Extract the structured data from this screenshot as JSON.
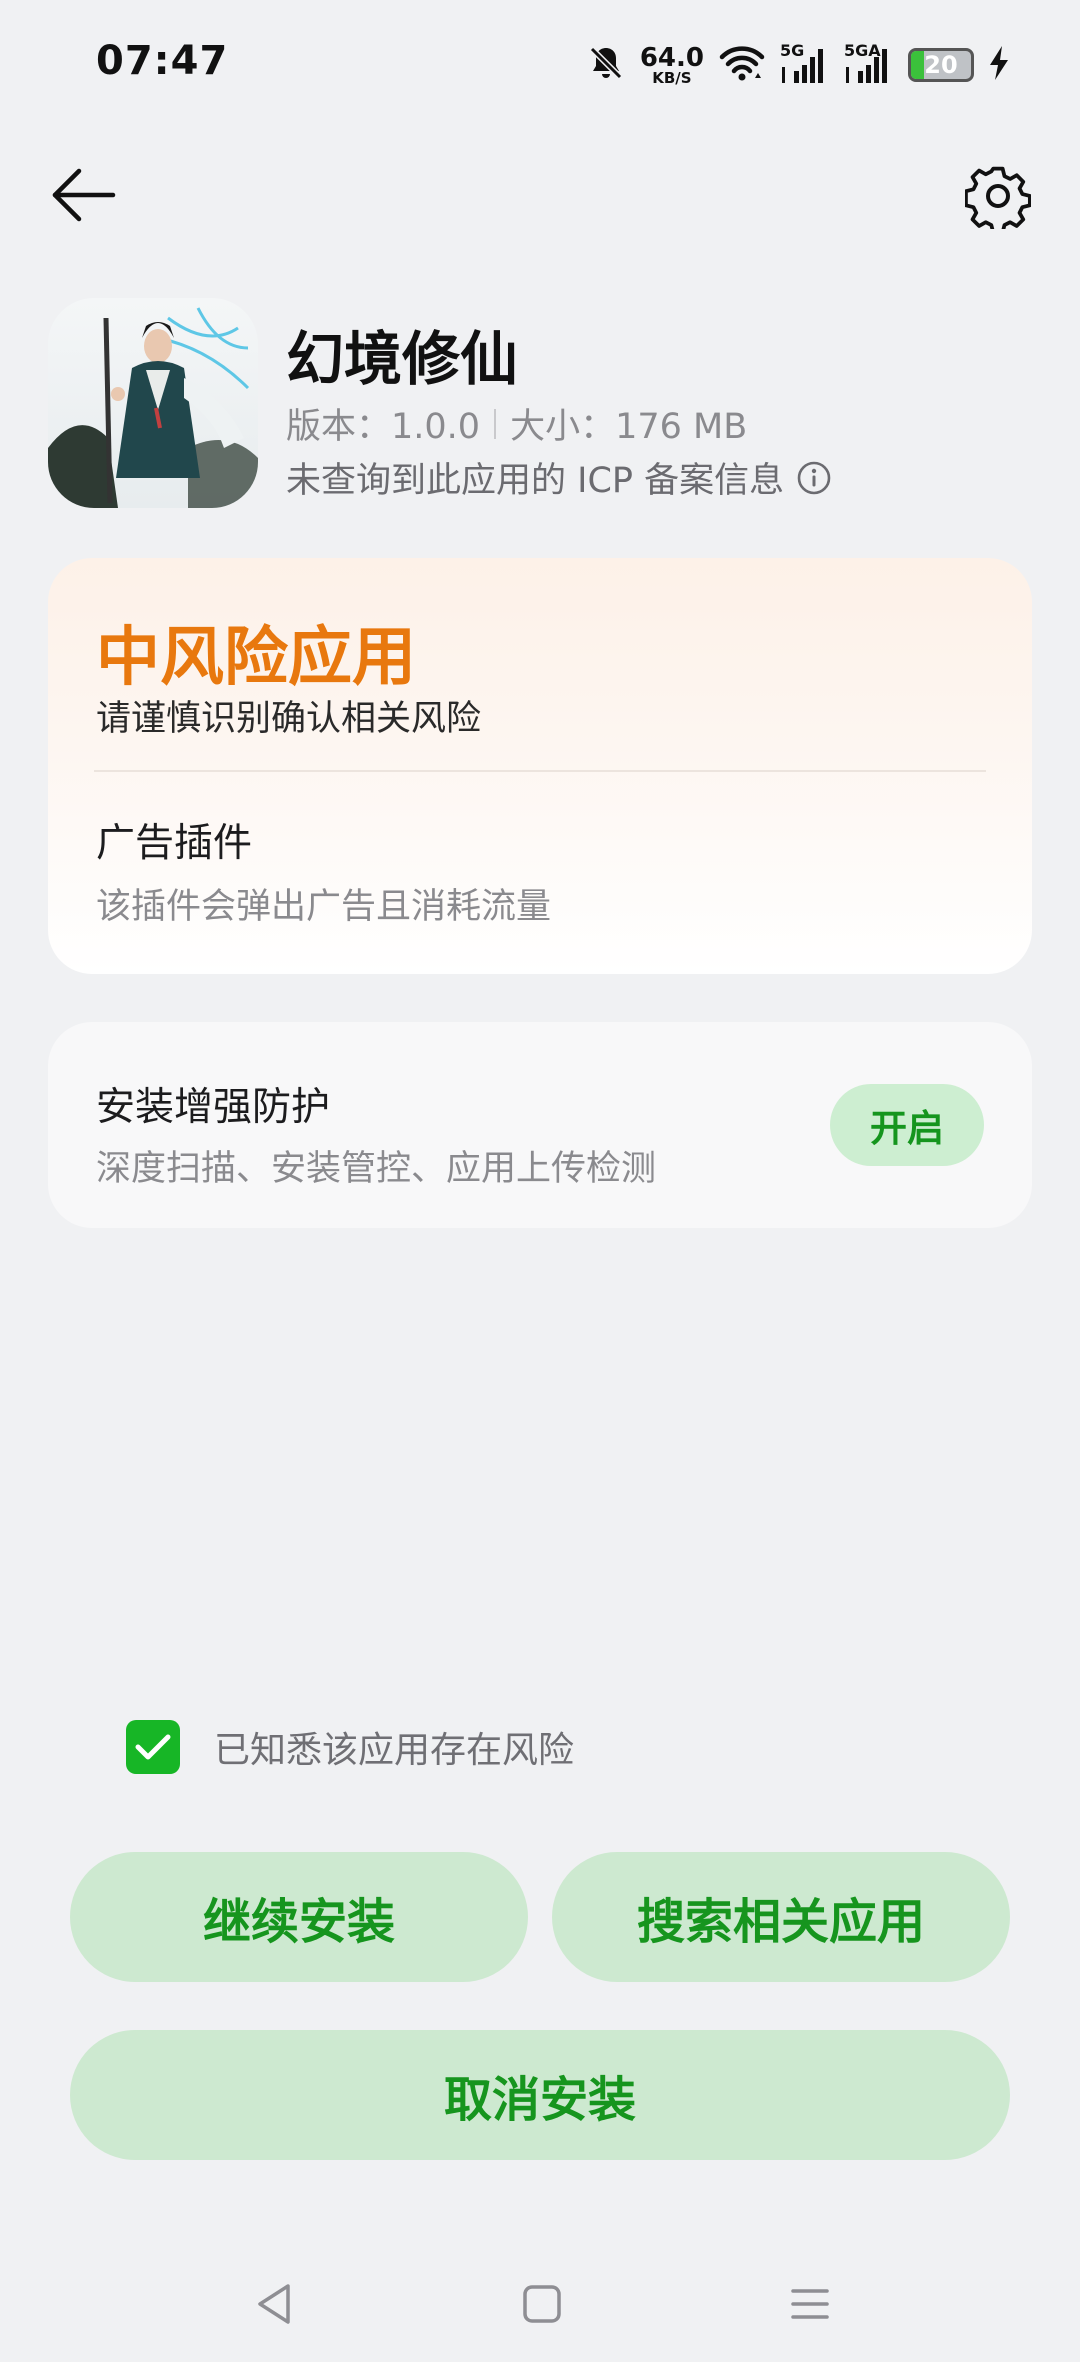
{
  "status_bar": {
    "time": "07:47",
    "net_speed": "64.0",
    "net_unit": "KB/S",
    "signal_1_label": "5G",
    "signal_2_label": "5GA",
    "battery": "20",
    "icons": [
      "mute-bell-icon",
      "wifi-icon",
      "signal-icon",
      "signal-icon",
      "battery-icon",
      "charging-icon"
    ]
  },
  "header": {
    "back_icon": "arrow-left-icon",
    "settings_icon": "gear-icon"
  },
  "app": {
    "name": "幻境修仙",
    "version": "版本：1.0.0",
    "size": "大小：176 MB",
    "icp_notice": "未查询到此应用的 ICP 备案信息"
  },
  "risk": {
    "level": "中风险应用",
    "subtitle": "请谨慎识别确认相关风险",
    "item_title": "广告插件",
    "item_desc": "该插件会弹出广告且消耗流量",
    "accent_color": "#e8780e"
  },
  "protection": {
    "title": "安装增强防护",
    "desc": "深度扫描、安装管控、应用上传检测",
    "button": "开启"
  },
  "acknowledge": {
    "checked": true,
    "label": "已知悉该应用存在风险"
  },
  "actions": {
    "continue": "继续安装",
    "search": "搜索相关应用",
    "cancel": "取消安装",
    "color": "#16951e"
  },
  "nav": {
    "icons": [
      "triangle-back-icon",
      "square-home-icon",
      "menu-lines-icon"
    ]
  }
}
